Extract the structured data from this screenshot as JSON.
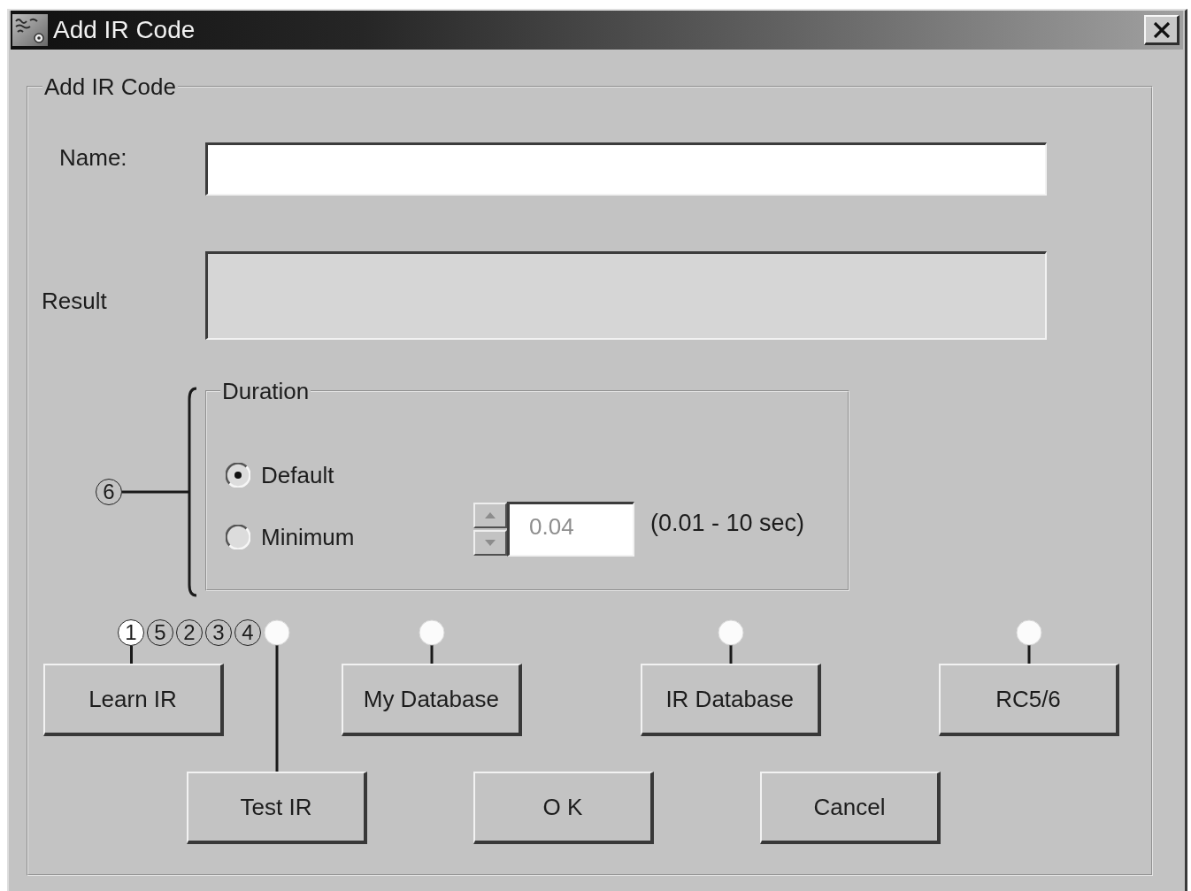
{
  "window": {
    "title": "Add IR Code"
  },
  "group": {
    "title": "Add IR Code"
  },
  "name_field": {
    "label": "Name:"
  },
  "result_field": {
    "label": "Result"
  },
  "duration": {
    "title": "Duration",
    "callout": {
      "label": "6",
      "filled": false
    },
    "options": [
      {
        "label": "Default",
        "selected": true
      },
      {
        "label": "Minimum",
        "selected": false
      }
    ],
    "value": "0.04",
    "value_disabled": true,
    "range": "(0.01 - 10 sec)"
  },
  "button_rows": [
    [
      {
        "label": "Learn IR",
        "marker": false,
        "callouts": [
          {
            "label": "1",
            "filled": true
          },
          {
            "label": "5",
            "filled": false
          },
          {
            "label": "2",
            "filled": false
          },
          {
            "label": "3",
            "filled": false
          },
          {
            "label": "4",
            "filled": false
          }
        ]
      },
      {
        "label": "My Database",
        "marker": true
      },
      {
        "label": "IR Database",
        "marker": true
      },
      {
        "label": "RC5/6",
        "marker": true
      }
    ],
    [
      {
        "label": "Test IR",
        "marker": true
      },
      {
        "label": "O K",
        "marker": false
      },
      {
        "label": "Cancel",
        "marker": false
      }
    ]
  ]
}
